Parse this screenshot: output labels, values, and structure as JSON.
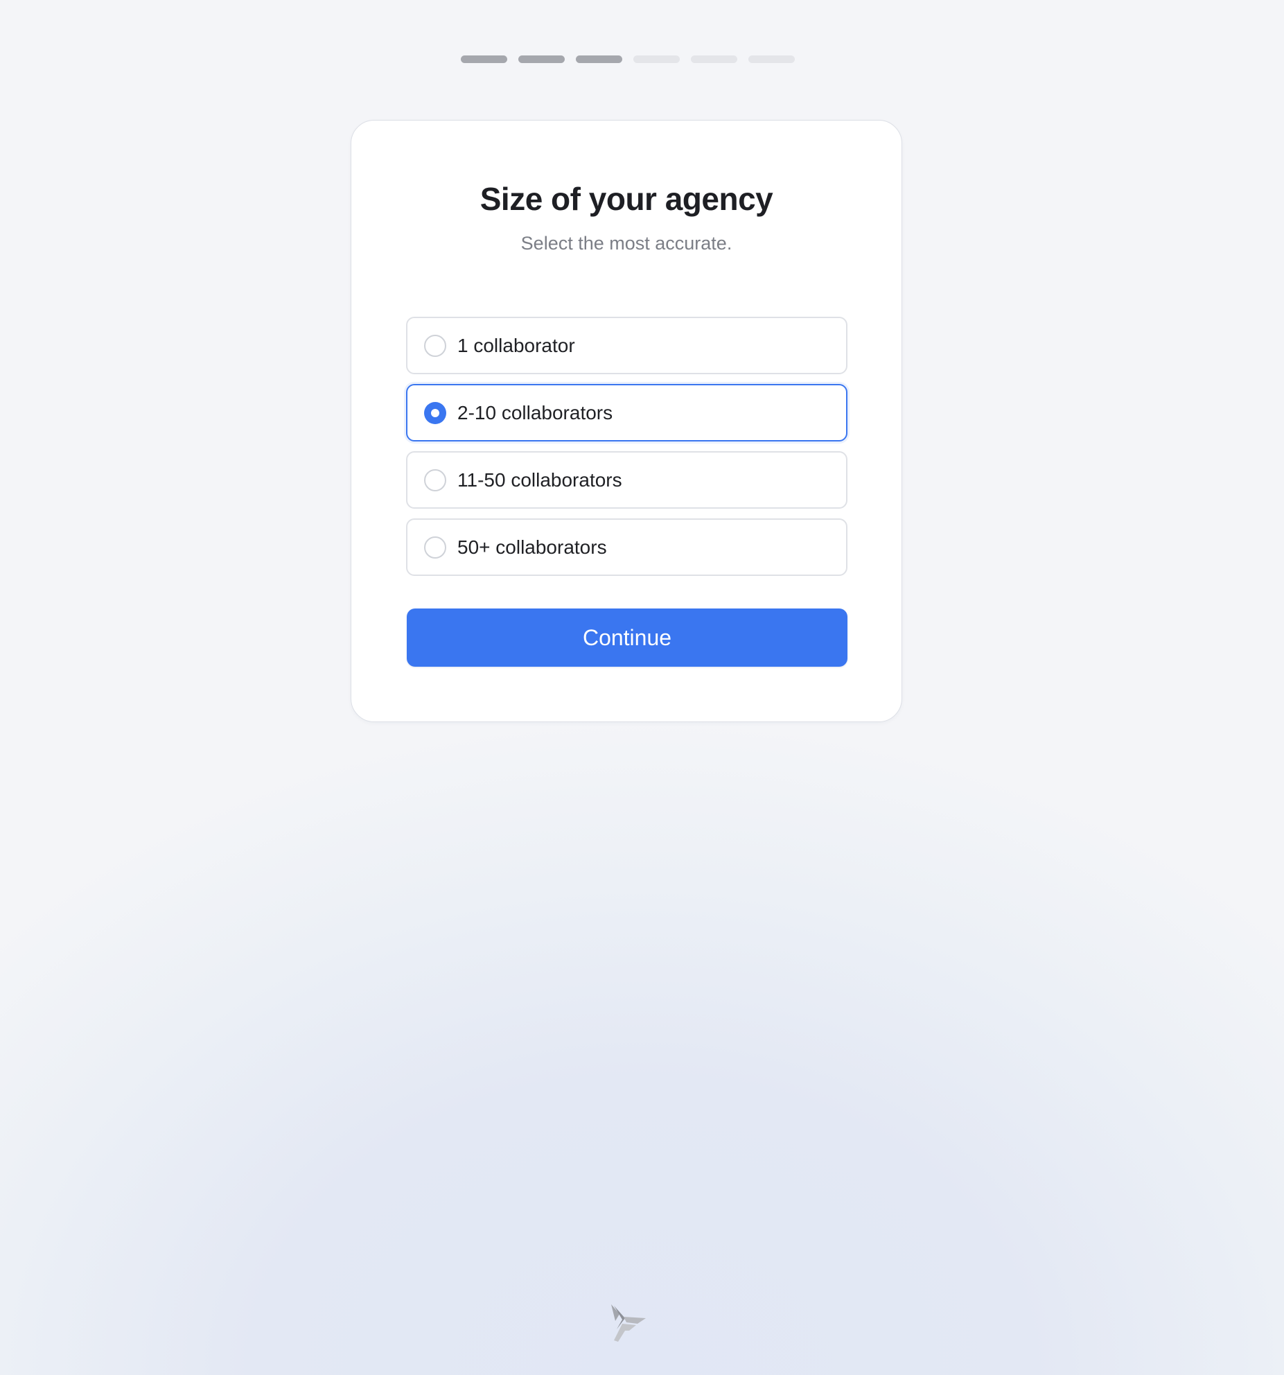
{
  "progress": {
    "total_steps": 6,
    "completed_steps": 3
  },
  "title": "Size of your agency",
  "subtitle": "Select the most accurate.",
  "options": [
    {
      "label": "1 collaborator",
      "selected": false
    },
    {
      "label": "2-10 collaborators",
      "selected": true
    },
    {
      "label": "11-50 collaborators",
      "selected": false
    },
    {
      "label": "50+ collaborators",
      "selected": false
    }
  ],
  "continue_label": "Continue",
  "colors": {
    "accent": "#3a76f0",
    "step_done": "#a5a7ad",
    "step_todo": "#e4e5e9"
  },
  "icons": {
    "footer_logo": "brand-logo-icon"
  }
}
